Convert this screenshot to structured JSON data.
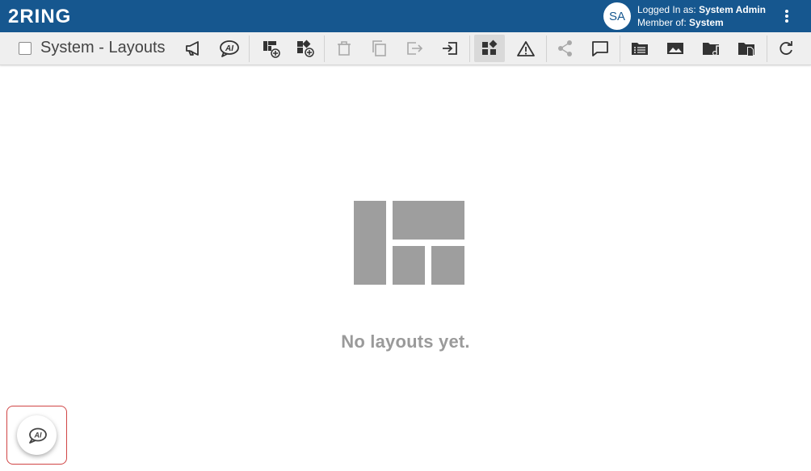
{
  "app": {
    "brand": "2RING"
  },
  "header": {
    "avatar_initials": "SA",
    "logged_in_label": "Logged In as:",
    "logged_in_user": "System Admin",
    "member_label": "Member of:",
    "member_group": "System"
  },
  "toolbar": {
    "title": "System - Layouts",
    "buttons": [
      {
        "icon": "megaphone-icon"
      },
      {
        "icon": "ai-chat-icon"
      },
      {
        "icon": "add-layout-icon"
      },
      {
        "icon": "add-widget-layout-icon"
      },
      {
        "icon": "delete-icon"
      },
      {
        "icon": "copy-icon"
      },
      {
        "icon": "export-icon"
      },
      {
        "icon": "import-icon"
      },
      {
        "icon": "widgets-icon"
      },
      {
        "icon": "warning-icon"
      },
      {
        "icon": "share-icon"
      },
      {
        "icon": "comment-icon"
      },
      {
        "icon": "folder-list-icon"
      },
      {
        "icon": "image-icon"
      },
      {
        "icon": "music-folder-icon"
      },
      {
        "icon": "document-folder-icon"
      },
      {
        "icon": "refresh-icon"
      }
    ]
  },
  "main": {
    "empty_message": "No layouts yet."
  },
  "ai_fab": {
    "icon": "ai-chat-icon"
  },
  "colors": {
    "header_bg": "#16578f",
    "highlight_border": "#d04545",
    "illustration": "#9e9e9e"
  }
}
